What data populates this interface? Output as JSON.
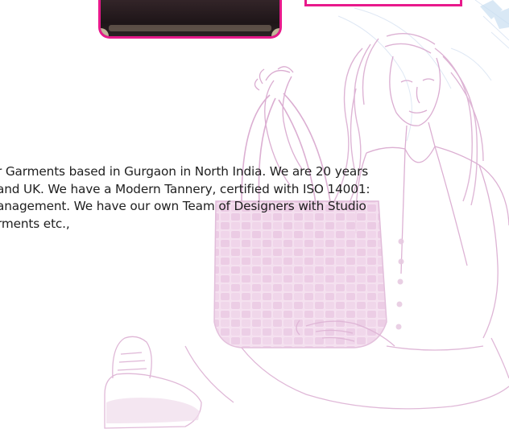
{
  "intro": {
    "lines": [
      "r Garments based in Gurgaon in North India. We are 20 years",
      "and UK. We have a Modern Tannery, certified with ISO 14001:",
      "anagement. We have our own Team of Designers with Studio",
      "rments etc.,"
    ]
  },
  "colors": {
    "accent": "#e8198b",
    "illustration": "#d9a9cf",
    "text": "#1f1f1f"
  },
  "icons": {
    "background": "woman-with-handbag-illustration",
    "product": "leather-bag-photo"
  }
}
